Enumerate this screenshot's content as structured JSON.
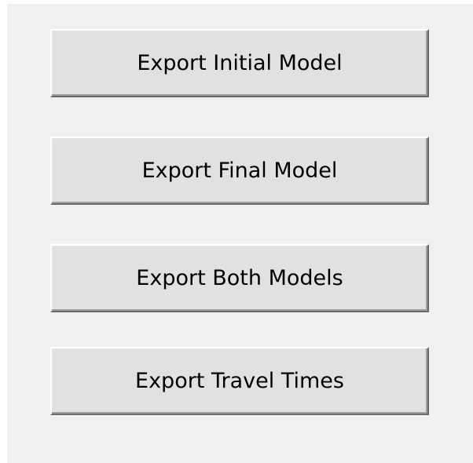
{
  "buttons": {
    "export_initial_model": "Export Initial Model",
    "export_final_model": "Export Final Model",
    "export_both_models": "Export Both Models",
    "export_travel_times": "Export Travel Times"
  },
  "colors": {
    "panel_background": "#f0f0f0",
    "button_face": "#e1e1e1",
    "button_highlight": "#ffffff",
    "button_shadow": "#696969"
  }
}
